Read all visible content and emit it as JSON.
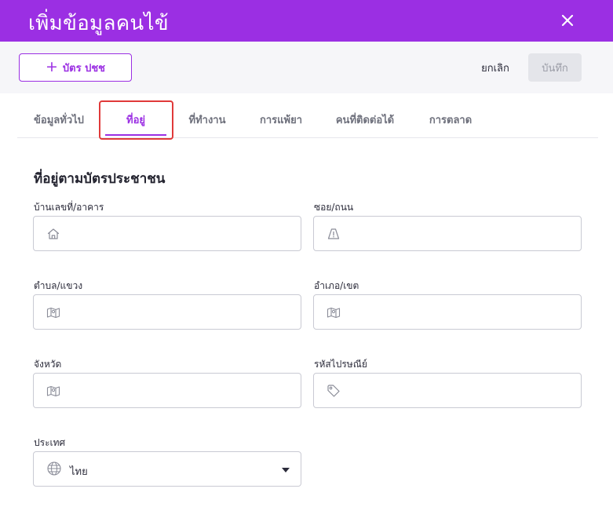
{
  "header": {
    "title": "เพิ่มข้อมูลคนไข้"
  },
  "toolbar": {
    "idcard_label": "บัตร ปชช",
    "cancel_label": "ยกเลิก",
    "save_label": "บันทึก"
  },
  "tabs": [
    {
      "label": "ข้อมูลทั่วไป",
      "active": false
    },
    {
      "label": "ที่อยู่",
      "active": true
    },
    {
      "label": "ที่ทำงาน",
      "active": false
    },
    {
      "label": "การแพ้ยา",
      "active": false
    },
    {
      "label": "คนที่ติดต่อได้",
      "active": false
    },
    {
      "label": "การตลาด",
      "active": false
    }
  ],
  "section": {
    "title": "ที่อยู่ตามบัตรประชาชน"
  },
  "fields": {
    "house": {
      "label": "บ้านเลขที่/อาคาร",
      "value": "",
      "icon": "home-icon"
    },
    "road": {
      "label": "ซอย/ถนน",
      "value": "",
      "icon": "road-sign-icon"
    },
    "subdistrict": {
      "label": "ตำบล/แขวง",
      "value": "",
      "icon": "map-icon"
    },
    "district": {
      "label": "อำเภอ/เขต",
      "value": "",
      "icon": "map-icon"
    },
    "province": {
      "label": "จังหวัด",
      "value": "",
      "icon": "map-icon"
    },
    "postcode": {
      "label": "รหัสไปรษณีย์",
      "value": "",
      "icon": "tag-icon"
    },
    "country": {
      "label": "ประเทศ",
      "value": "ไทย",
      "icon": "globe-icon"
    }
  },
  "colors": {
    "accent": "#9b2fe3",
    "highlight": "#e03a3a",
    "save_disabled": "#e4e5ea"
  }
}
